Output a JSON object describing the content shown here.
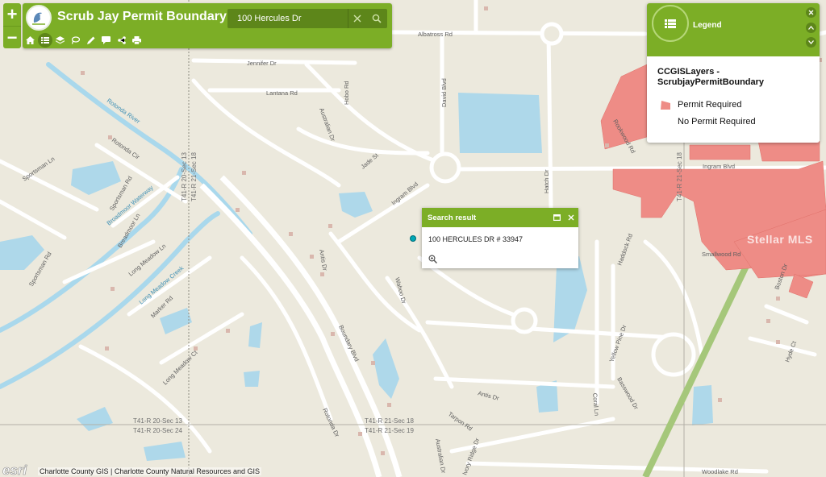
{
  "header": {
    "title": "Scrub Jay Permit Boundary",
    "search": {
      "value": "100 Hercules Dr",
      "placeholder": ""
    },
    "tools": [
      {
        "icon": "home-icon"
      },
      {
        "icon": "list-icon"
      },
      {
        "icon": "layers-icon"
      },
      {
        "icon": "lasso-icon"
      },
      {
        "icon": "pencil-icon"
      },
      {
        "icon": "comment-icon"
      },
      {
        "icon": "share-icon"
      },
      {
        "icon": "print-icon"
      }
    ]
  },
  "zoom": {
    "in_label": "+",
    "out_label": "−"
  },
  "legend": {
    "title": "Legend",
    "layer_name": "CCGISLayers -\nScrubjayPermitBoundary",
    "items": [
      {
        "label": "Permit Required",
        "color": "#ee8c86"
      },
      {
        "label": "No Permit Required",
        "color": "#ffffff"
      }
    ]
  },
  "popup": {
    "title": "Search result",
    "content": "100 HERCULES DR # 33947"
  },
  "map": {
    "streets": [
      "Albatross Rd",
      "Jennifer Dr",
      "Lantana Rd",
      "Hobo Rd",
      "David Blvd",
      "Australian Dr",
      "Jade St",
      "Ingram Blvd",
      "Rotonda Cir",
      "Sportsman Ln",
      "Sportsman Rd",
      "Breadmoor Ln",
      "Long Meadow Ln",
      "Marker Rd",
      "Long Meadow Ct",
      "Antis Dr",
      "Wahoo Dr",
      "Boundary Blvd",
      "Haddock Rd",
      "Smallwood Rd",
      "Boston Dr",
      "Yellow Pine Dr",
      "Basswood Dr",
      "Hyde Ct",
      "Coral Ln",
      "Tarpon Rd",
      "Rotonda Dr",
      "Ivory Ridge Dr",
      "Woodlake Rd",
      "Antis Dr",
      "Ingram Blvd",
      "Rookwood Rd"
    ],
    "water": [
      "Rotonda River",
      "Broadmoor Waterway",
      "Long Meadow Creek"
    ],
    "sections": [
      "T41-R 20-Sec 13",
      "T41-R 21-Sec 18",
      "T41-R 20-Sec 13",
      "T41-R 21-Sec 18",
      "T41-R 20-Sec 24",
      "T41-R 21-Sec 19"
    ]
  },
  "attribution": {
    "esri": "esri",
    "text": "Charlotte County GIS | Charlotte County Natural Resources and GIS",
    "watermark": "Stellar MLS"
  }
}
